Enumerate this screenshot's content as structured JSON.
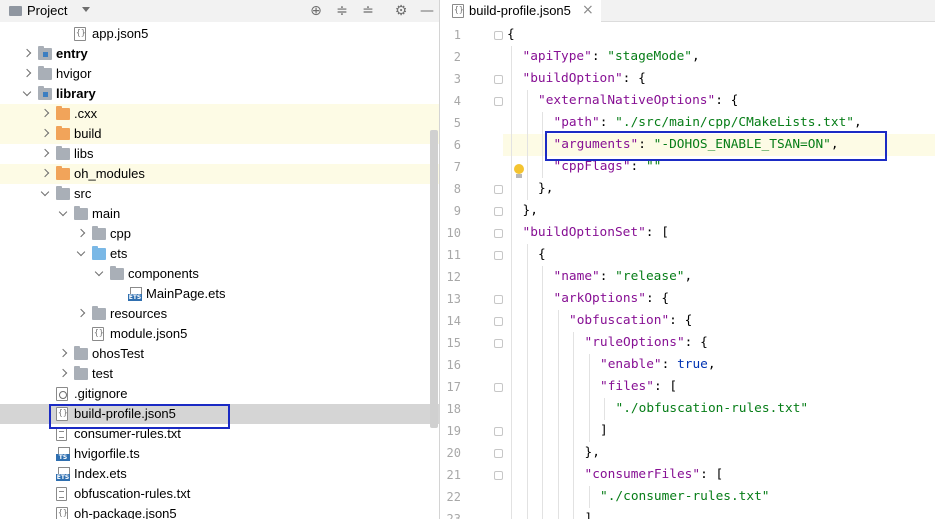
{
  "project_panel": {
    "title": "Project",
    "toolbar_icons": [
      "locate-icon",
      "expand-all-icon",
      "collapse-all-icon",
      "gear-icon",
      "minimize-icon"
    ],
    "tree": [
      {
        "label": "app.json5",
        "icon": "json5-file-icon",
        "indent": 3,
        "chevron": "none",
        "bold": false,
        "highlight": "none"
      },
      {
        "label": "entry",
        "icon": "module-folder-icon",
        "indent": 1,
        "chevron": "right",
        "bold": true,
        "highlight": "none"
      },
      {
        "label": "hvigor",
        "icon": "folder-icon",
        "indent": 1,
        "chevron": "right",
        "bold": false,
        "highlight": "none"
      },
      {
        "label": "library",
        "icon": "module-folder-icon",
        "indent": 1,
        "chevron": "down",
        "bold": true,
        "highlight": "none"
      },
      {
        "label": ".cxx",
        "icon": "excluded-folder-icon",
        "indent": 2,
        "chevron": "right",
        "bold": false,
        "highlight": "yellow"
      },
      {
        "label": "build",
        "icon": "excluded-folder-icon",
        "indent": 2,
        "chevron": "right",
        "bold": false,
        "highlight": "yellow"
      },
      {
        "label": "libs",
        "icon": "folder-icon",
        "indent": 2,
        "chevron": "right",
        "bold": false,
        "highlight": "none"
      },
      {
        "label": "oh_modules",
        "icon": "excluded-folder-icon",
        "indent": 2,
        "chevron": "right",
        "bold": false,
        "highlight": "yellow"
      },
      {
        "label": "src",
        "icon": "folder-icon",
        "indent": 2,
        "chevron": "down",
        "bold": false,
        "highlight": "none"
      },
      {
        "label": "main",
        "icon": "folder-icon",
        "indent": 3,
        "chevron": "down",
        "bold": false,
        "highlight": "none"
      },
      {
        "label": "cpp",
        "icon": "folder-icon",
        "indent": 4,
        "chevron": "right",
        "bold": false,
        "highlight": "none"
      },
      {
        "label": "ets",
        "icon": "source-folder-icon",
        "indent": 4,
        "chevron": "down",
        "bold": false,
        "highlight": "none"
      },
      {
        "label": "components",
        "icon": "folder-icon",
        "indent": 5,
        "chevron": "down",
        "bold": false,
        "highlight": "none"
      },
      {
        "label": "MainPage.ets",
        "icon": "ets-file-icon",
        "indent": 6,
        "chevron": "none",
        "bold": false,
        "highlight": "none"
      },
      {
        "label": "resources",
        "icon": "folder-icon",
        "indent": 4,
        "chevron": "right",
        "bold": false,
        "highlight": "none"
      },
      {
        "label": "module.json5",
        "icon": "json5-file-icon",
        "indent": 4,
        "chevron": "none",
        "bold": false,
        "highlight": "none"
      },
      {
        "label": "ohosTest",
        "icon": "folder-icon",
        "indent": 3,
        "chevron": "right",
        "bold": false,
        "highlight": "none"
      },
      {
        "label": "test",
        "icon": "folder-icon",
        "indent": 3,
        "chevron": "right",
        "bold": false,
        "highlight": "none"
      },
      {
        "label": ".gitignore",
        "icon": "gitignore-file-icon",
        "indent": 2,
        "chevron": "none",
        "bold": false,
        "highlight": "none"
      },
      {
        "label": "build-profile.json5",
        "icon": "json5-file-icon",
        "indent": 2,
        "chevron": "none",
        "bold": false,
        "highlight": "selected"
      },
      {
        "label": "consumer-rules.txt",
        "icon": "text-file-icon",
        "indent": 2,
        "chevron": "none",
        "bold": false,
        "highlight": "none"
      },
      {
        "label": "hvigorfile.ts",
        "icon": "ts-file-icon",
        "indent": 2,
        "chevron": "none",
        "bold": false,
        "highlight": "none"
      },
      {
        "label": "Index.ets",
        "icon": "ets-file-icon",
        "indent": 2,
        "chevron": "none",
        "bold": false,
        "highlight": "none"
      },
      {
        "label": "obfuscation-rules.txt",
        "icon": "text-file-icon",
        "indent": 2,
        "chevron": "none",
        "bold": false,
        "highlight": "none"
      },
      {
        "label": "oh-package.json5",
        "icon": "json5-file-icon",
        "indent": 2,
        "chevron": "none",
        "bold": false,
        "highlight": "none"
      }
    ]
  },
  "editor": {
    "tab": {
      "label": "build-profile.json5",
      "close": "×",
      "icon": "json5-file-icon"
    },
    "current_line": 6,
    "lines": [
      {
        "n": "1",
        "indent": 0,
        "tokens": [
          {
            "t": "{",
            "c": "pun"
          }
        ]
      },
      {
        "n": "2",
        "indent": 1,
        "tokens": [
          {
            "t": "\"apiType\"",
            "c": "key"
          },
          {
            "t": ": ",
            "c": "pun"
          },
          {
            "t": "\"stageMode\"",
            "c": "str"
          },
          {
            "t": ",",
            "c": "pun"
          }
        ]
      },
      {
        "n": "3",
        "indent": 1,
        "tokens": [
          {
            "t": "\"buildOption\"",
            "c": "key"
          },
          {
            "t": ": {",
            "c": "pun"
          }
        ]
      },
      {
        "n": "4",
        "indent": 2,
        "tokens": [
          {
            "t": "\"externalNativeOptions\"",
            "c": "key"
          },
          {
            "t": ": {",
            "c": "pun"
          }
        ]
      },
      {
        "n": "5",
        "indent": 3,
        "tokens": [
          {
            "t": "\"path\"",
            "c": "key"
          },
          {
            "t": ": ",
            "c": "pun"
          },
          {
            "t": "\"./src/main/cpp/CMakeLists.txt\"",
            "c": "str"
          },
          {
            "t": ",",
            "c": "pun"
          }
        ]
      },
      {
        "n": "6",
        "indent": 3,
        "tokens": [
          {
            "t": "\"arguments\"",
            "c": "key"
          },
          {
            "t": ": ",
            "c": "pun"
          },
          {
            "t": "\"-DOHOS_ENABLE_TSAN=ON\"",
            "c": "str"
          },
          {
            "t": ",",
            "c": "pun"
          }
        ]
      },
      {
        "n": "7",
        "indent": 3,
        "tokens": [
          {
            "t": "\"cppFlags\"",
            "c": "key"
          },
          {
            "t": ": ",
            "c": "pun"
          },
          {
            "t": "\"\"",
            "c": "str"
          }
        ]
      },
      {
        "n": "8",
        "indent": 2,
        "tokens": [
          {
            "t": "},",
            "c": "pun"
          }
        ]
      },
      {
        "n": "9",
        "indent": 1,
        "tokens": [
          {
            "t": "},",
            "c": "pun"
          }
        ]
      },
      {
        "n": "10",
        "indent": 1,
        "tokens": [
          {
            "t": "\"buildOptionSet\"",
            "c": "key"
          },
          {
            "t": ": [",
            "c": "pun"
          }
        ]
      },
      {
        "n": "11",
        "indent": 2,
        "tokens": [
          {
            "t": "{",
            "c": "pun"
          }
        ]
      },
      {
        "n": "12",
        "indent": 3,
        "tokens": [
          {
            "t": "\"name\"",
            "c": "key"
          },
          {
            "t": ": ",
            "c": "pun"
          },
          {
            "t": "\"release\"",
            "c": "str"
          },
          {
            "t": ",",
            "c": "pun"
          }
        ]
      },
      {
        "n": "13",
        "indent": 3,
        "tokens": [
          {
            "t": "\"arkOptions\"",
            "c": "key"
          },
          {
            "t": ": {",
            "c": "pun"
          }
        ]
      },
      {
        "n": "14",
        "indent": 4,
        "tokens": [
          {
            "t": "\"obfuscation\"",
            "c": "key"
          },
          {
            "t": ": {",
            "c": "pun"
          }
        ]
      },
      {
        "n": "15",
        "indent": 5,
        "tokens": [
          {
            "t": "\"ruleOptions\"",
            "c": "key"
          },
          {
            "t": ": {",
            "c": "pun"
          }
        ]
      },
      {
        "n": "16",
        "indent": 6,
        "tokens": [
          {
            "t": "\"enable\"",
            "c": "key"
          },
          {
            "t": ": ",
            "c": "pun"
          },
          {
            "t": "true",
            "c": "kw"
          },
          {
            "t": ",",
            "c": "pun"
          }
        ]
      },
      {
        "n": "17",
        "indent": 6,
        "tokens": [
          {
            "t": "\"files\"",
            "c": "key"
          },
          {
            "t": ": [",
            "c": "pun"
          }
        ]
      },
      {
        "n": "18",
        "indent": 7,
        "tokens": [
          {
            "t": "\"./obfuscation-rules.txt\"",
            "c": "str"
          }
        ]
      },
      {
        "n": "19",
        "indent": 6,
        "tokens": [
          {
            "t": "]",
            "c": "pun"
          }
        ]
      },
      {
        "n": "20",
        "indent": 5,
        "tokens": [
          {
            "t": "},",
            "c": "pun"
          }
        ]
      },
      {
        "n": "21",
        "indent": 5,
        "tokens": [
          {
            "t": "\"consumerFiles\"",
            "c": "key"
          },
          {
            "t": ": [",
            "c": "pun"
          }
        ]
      },
      {
        "n": "22",
        "indent": 6,
        "tokens": [
          {
            "t": "\"./consumer-rules.txt\"",
            "c": "str"
          }
        ]
      },
      {
        "n": "23",
        "indent": 5,
        "tokens": [
          {
            "t": "]",
            "c": "pun"
          }
        ]
      }
    ]
  },
  "colors": {
    "annotation_box": "#1b2bc4",
    "key": "#871094",
    "string": "#067d17",
    "keyword": "#0033b3",
    "current_line": "#fdfbe5"
  }
}
